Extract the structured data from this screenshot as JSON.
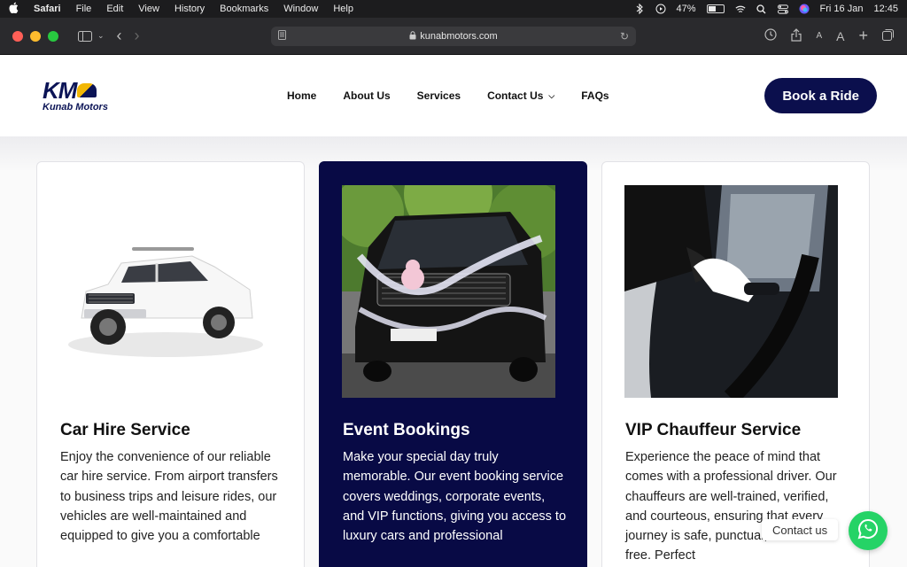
{
  "menubar": {
    "app": "Safari",
    "items": [
      "File",
      "Edit",
      "View",
      "History",
      "Bookmarks",
      "Window",
      "Help"
    ],
    "battery": "47%",
    "battery_level": 0.47,
    "date": "Fri 16 Jan",
    "time": "12:45"
  },
  "browser": {
    "url": "kunabmotors.com"
  },
  "site": {
    "logo_mark": "KM",
    "logo_name": "Kunab Motors",
    "nav": {
      "home": "Home",
      "about": "About Us",
      "services": "Services",
      "contact": "Contact Us",
      "faqs": "FAQs"
    },
    "cta": "Book a Ride"
  },
  "cards": [
    {
      "title": "Car Hire Service",
      "text": "Enjoy the convenience of our reliable car hire service. From airport transfers to business trips and leisure rides, our vehicles are well-maintained and equipped to give you a comfortable"
    },
    {
      "title": "Event Bookings",
      "text": "Make your special day truly memorable. Our event booking service covers weddings, corporate events, and VIP functions, giving you access to luxury cars and professional"
    },
    {
      "title": "VIP Chauffeur Service",
      "text": "Experience the peace of mind that comes with a professional driver. Our chauffeurs are well-trained, verified, and courteous, ensuring that every journey is safe, punctual, and stress-free. Perfect"
    }
  ],
  "chat": {
    "label": "Contact us"
  }
}
